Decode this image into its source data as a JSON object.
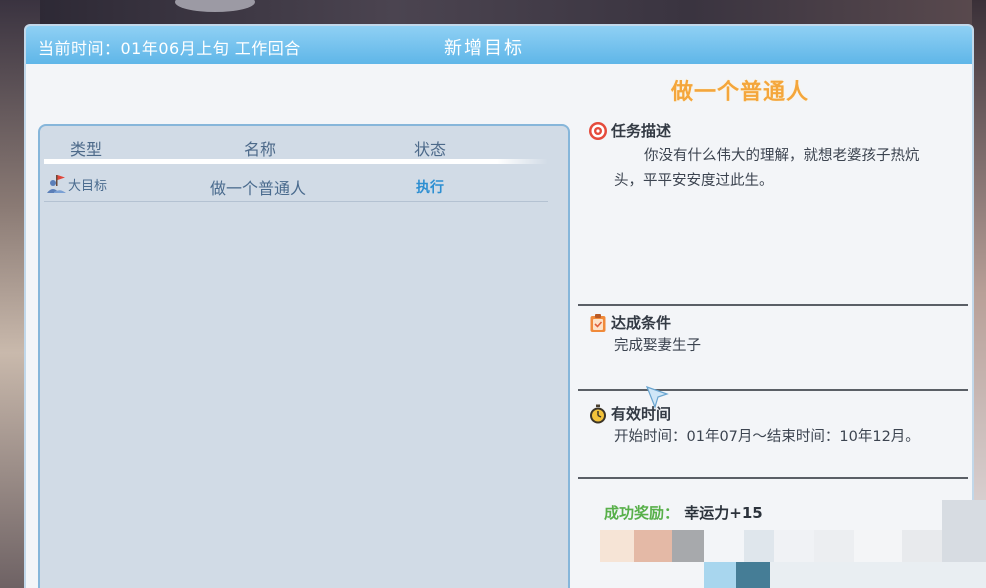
{
  "header": {
    "time_label": "当前时间：01年06月上旬 工作回合",
    "title": "新增目标"
  },
  "goal_name": "做一个普通人",
  "list": {
    "columns": [
      "类型",
      "名称",
      "状态"
    ],
    "rows": [
      {
        "type": "大目标",
        "name": "做一个普通人",
        "status": "执行"
      }
    ]
  },
  "details": {
    "description": {
      "title": "任务描述",
      "text": "你没有什么伟大的理解，就想老婆孩子热炕头，平平安安度过此生。"
    },
    "condition": {
      "title": "达成条件",
      "text": "完成娶妻生子"
    },
    "valid_time": {
      "title": "有效时间",
      "text": "开始时间：01年07月～结束时间：10年12月。"
    },
    "reward": {
      "label": "成功奖励：",
      "value": "幸运力+15"
    }
  },
  "colors": {
    "titlebar": "#5fb6e8",
    "goal_name": "#f4a63c",
    "reward_label": "#58b04a",
    "status": "#2d8fd2"
  },
  "icons": {
    "type": "flag-person-icon",
    "description": "target-icon",
    "condition": "clipboard-icon",
    "valid_time": "stopwatch-icon"
  }
}
